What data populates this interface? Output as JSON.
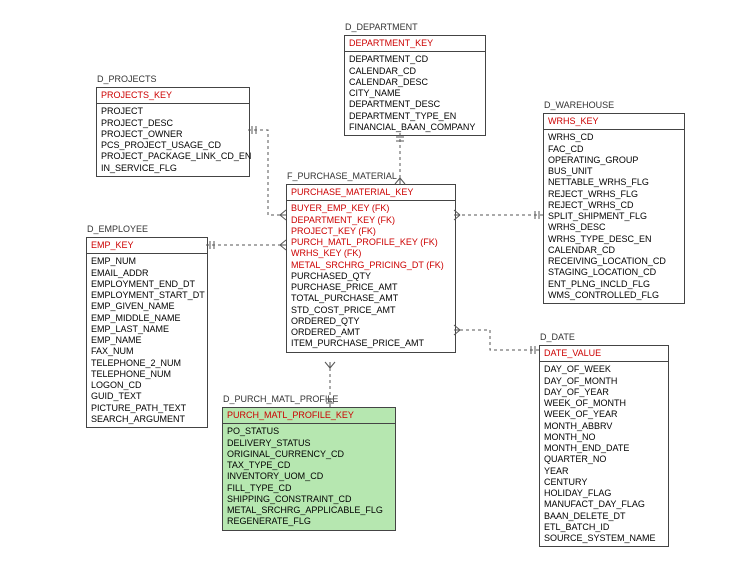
{
  "entities": {
    "projects": {
      "title": "D_PROJECTS",
      "key": "PROJECTS_KEY",
      "cols": [
        "PROJECT",
        "PROJECT_DESC",
        "PROJECT_OWNER",
        "PCS_PROJECT_USAGE_CD",
        "PROJECT_PACKAGE_LINK_CD_EN",
        "IN_SERVICE_FLG"
      ]
    },
    "department": {
      "title": "D_DEPARTMENT",
      "key": "DEPARTMENT_KEY",
      "cols": [
        "DEPARTMENT_CD",
        "CALENDAR_CD",
        "CALENDAR_DESC",
        "CITY_NAME",
        "DEPARTMENT_DESC",
        "DEPARTMENT_TYPE_EN",
        "FINANCIAL_BAAN_COMPANY"
      ]
    },
    "warehouse": {
      "title": "D_WAREHOUSE",
      "key": "WRHS_KEY",
      "cols": [
        "WRHS_CD",
        "FAC_CD",
        "OPERATING_GROUP",
        "BUS_UNIT",
        "NETTABLE_WRHS_FLG",
        "REJECT_WRHS_FLG",
        "REJECT_WRHS_CD",
        "SPLIT_SHIPMENT_FLG",
        "WRHS_DESC",
        "WRHS_TYPE_DESC_EN",
        "CALENDAR_CD",
        "RECEIVING_LOCATION_CD",
        "STAGING_LOCATION_CD",
        "ENT_PLNG_INCLD_FLG",
        "WMS_CONTROLLED_FLG"
      ]
    },
    "employee": {
      "title": "D_EMPLOYEE",
      "key": "EMP_KEY",
      "cols": [
        "EMP_NUM",
        "EMAIL_ADDR",
        "EMPLOYMENT_END_DT",
        "EMPLOYMENT_START_DT",
        "EMP_GIVEN_NAME",
        "EMP_MIDDLE_NAME",
        "EMP_LAST_NAME",
        "EMP_NAME",
        "FAX_NUM",
        "TELEPHONE_2_NUM",
        "TELEPHONE_NUM",
        "LOGON_CD",
        "GUID_TEXT",
        "PICTURE_PATH_TEXT",
        "SEARCH_ARGUMENT"
      ]
    },
    "fact": {
      "title": "F_PURCHASE_MATERIAL",
      "key": "PURCHASE_MATERIAL_KEY",
      "fks": [
        "BUYER_EMP_KEY (FK)",
        "DEPARTMENT_KEY (FK)",
        "PROJECT_KEY (FK)",
        "PURCH_MATL_PROFILE_KEY (FK)",
        "WRHS_KEY (FK)",
        "METAL_SRCHRG_PRICING_DT (FK)"
      ],
      "cols": [
        "PURCHASED_QTY",
        "PURCHASE_PRICE_AMT",
        "TOTAL_PURCHASE_AMT",
        "STD_COST_PRICE_AMT",
        "ORDERED_QTY",
        "ORDERED_AMT",
        "ITEM_PURCHASE_PRICE_AMT"
      ]
    },
    "profile": {
      "title": "D_PURCH_MATL_PROFILE",
      "key": "PURCH_MATL_PROFILE_KEY",
      "cols": [
        "PO_STATUS",
        "DELIVERY_STATUS",
        "ORIGINAL_CURRENCY_CD",
        "TAX_TYPE_CD",
        "INVENTORY_UOM_CD",
        "FILL_TYPE_CD",
        "SHIPPING_CONSTRAINT_CD",
        "METAL_SRCHRG_APPLICABLE_FLG",
        "REGENERATE_FLG"
      ]
    },
    "date": {
      "title": "D_DATE",
      "key": "DATE_VALUE",
      "cols": [
        "DAY_OF_WEEK",
        "DAY_OF_MONTH",
        "DAY_OF_YEAR",
        "WEEK_OF_MONTH",
        "WEEK_OF_YEAR",
        "MONTH_ABBRV",
        "MONTH_NO",
        "MONTH_END_DATE",
        "QUARTER_NO",
        "YEAR",
        "CENTURY",
        "HOLIDAY_FLAG",
        "MANUFACT_DAY_FLAG",
        "BAAN_DELETE_DT",
        "ETL_BATCH_ID",
        "SOURCE_SYSTEM_NAME"
      ]
    }
  }
}
